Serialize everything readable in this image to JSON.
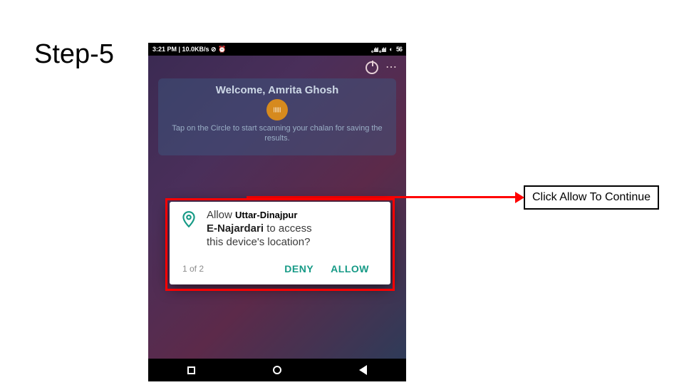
{
  "step": "Step-5",
  "statusbar": {
    "left": "3:21 PM | 10.0KB/s ⊘ ⏰",
    "signal": "｡ılıl ｡ılıl",
    "wifi": "◐",
    "battery": "56"
  },
  "welcome": {
    "greeting": "Welcome, Amrita Ghosh",
    "circle": "||||||",
    "sub": "Tap on the Circle to start scanning your chalan for saving the results."
  },
  "dialog": {
    "allow_word": "Allow",
    "district": "Uttar-Dinajpur",
    "appname": "E-Najardari",
    "rest1": " to access",
    "rest2": "this device's location?",
    "pager": "1 of 2",
    "deny": "DENY",
    "allow": "ALLOW"
  },
  "callout": "Click Allow To Continue"
}
